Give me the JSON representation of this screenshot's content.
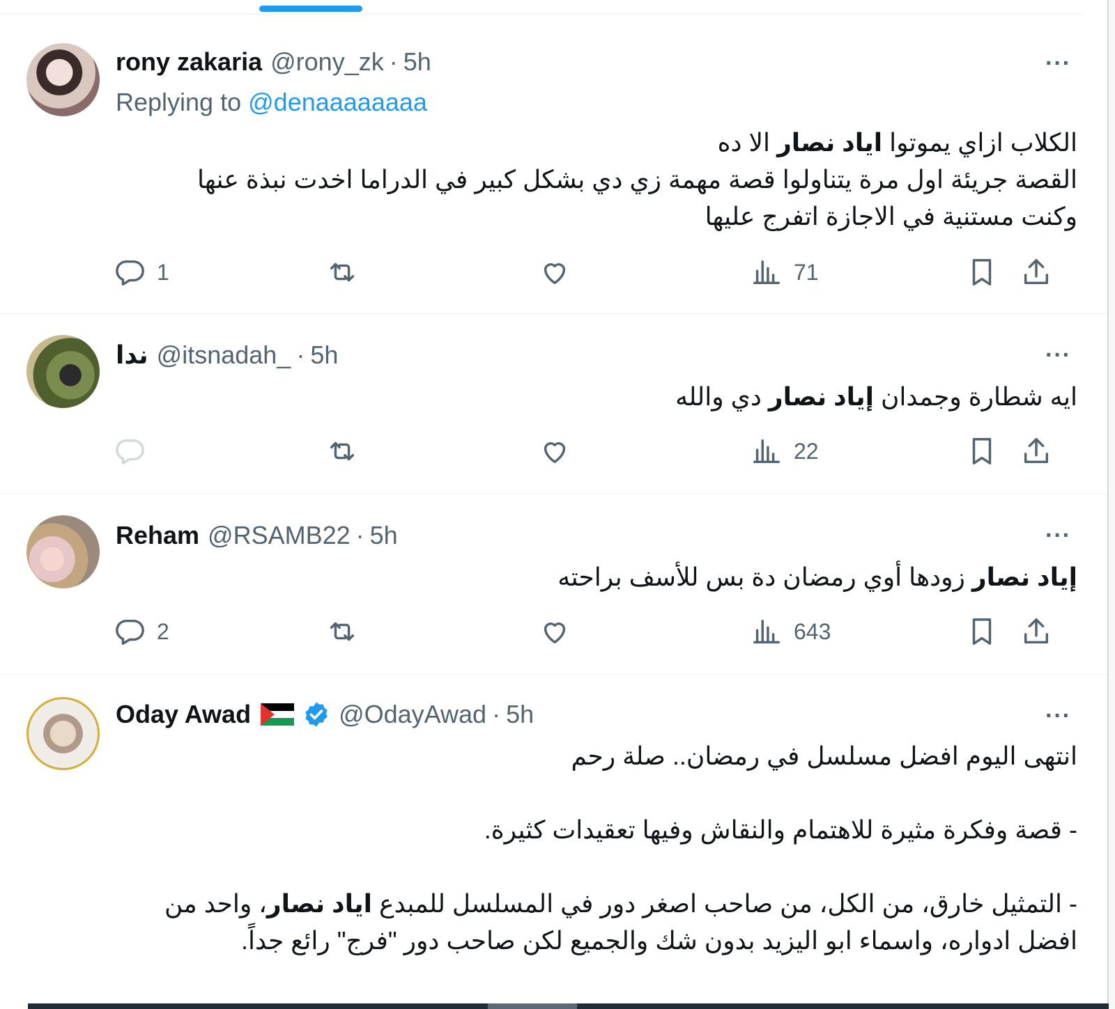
{
  "tweets": [
    {
      "name": "rony zakaria",
      "handle": "@rony_zk",
      "time": "5h",
      "replying_prefix": "Replying to",
      "replying_to": "@denaaaaaaaa",
      "lines": [
        {
          "pre": "الكلاب ازاي يموتوا ",
          "bold": "اياد نصار",
          "post": " الا ده"
        },
        {
          "pre": "القصة جريئة اول مرة يتناولوا قصة مهمة زي دي بشكل كبير في الدراما  اخدت نبذة عنها",
          "bold": "",
          "post": ""
        },
        {
          "pre": "وكنت مستنية في الاجازة اتفرج عليها",
          "bold": "",
          "post": ""
        }
      ],
      "replies": "1",
      "views": "71"
    },
    {
      "name": "ندا",
      "handle": "@itsnadah_",
      "time": "5h",
      "lines": [
        {
          "pre": "ايه شطارة وجمدان ",
          "bold": "إياد نصار",
          "post": " دي والله"
        }
      ],
      "replies": "",
      "views": "22"
    },
    {
      "name": "Reham",
      "handle": "@RSAMB22",
      "time": "5h",
      "lines": [
        {
          "pre": "",
          "bold": "إياد نصار",
          "post": " زودها أوي رمضان دة بس للأسف براحته"
        }
      ],
      "replies": "2",
      "views": "643"
    },
    {
      "name": "Oday Awad",
      "handle": "@OdayAwad",
      "time": "5h",
      "lines": [
        {
          "pre": "انتهى اليوم افضل مسلسل في رمضان.. صلة رحم",
          "bold": "",
          "post": ""
        },
        {
          "pre": "- قصة وفكرة مثيرة للاهتمام والنقاش وفيها تعقيدات كثيرة.",
          "bold": "",
          "post": ""
        },
        {
          "pre": "- التمثيل خارق، من الكل، من صاحب اصغر دور في المسلسل للمبدع ",
          "bold": "اياد نصار",
          "post": "، واحد من"
        },
        {
          "pre": "افضل ادواره، واسماء ابو اليزيد بدون شك والجميع لكن صاحب دور \"فرج\" رائع جداً.",
          "bold": "",
          "post": ""
        }
      ]
    }
  ],
  "more_label": "···",
  "icons": {
    "reply": "reply-icon",
    "retweet": "retweet-icon",
    "like": "heart-icon",
    "views": "views-icon",
    "bookmark": "bookmark-icon",
    "share": "share-icon",
    "flag": "palestine-flag-icon",
    "verified": "verified-badge-icon"
  },
  "colors": {
    "accent": "#1d9bf0",
    "text": "#0f1419",
    "secondary": "#536471"
  }
}
